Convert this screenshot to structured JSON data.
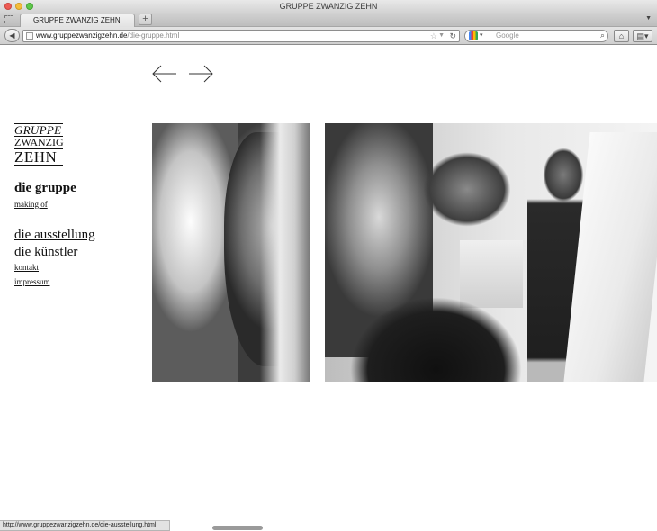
{
  "window": {
    "title": "GRUPPE ZWANZIG ZEHN"
  },
  "tabs": [
    {
      "label": "GRUPPE ZWANZIG ZEHN"
    }
  ],
  "toolbar": {
    "back_glyph": "◀",
    "new_tab_glyph": "+",
    "url_host": "www.gruppezwanzigzehn.de",
    "url_path": "/die-gruppe.html",
    "search_placeholder": "Google",
    "home_glyph": "⌂",
    "bookmarks_glyph": "▤▾"
  },
  "logo": {
    "line1": "GRUPPE",
    "line2": "ZWANZIG",
    "line3": "ZEHN"
  },
  "nav": {
    "die_gruppe": "die gruppe",
    "making_of": "making of",
    "die_ausstellung": "die ausstellung",
    "die_kuenstler": "die künstler",
    "kontakt": "kontakt",
    "impressum": "impressum"
  },
  "status_bar": {
    "text": "http://www.gruppezwanzigzehn.de/die-ausstellung.html"
  },
  "colors": {
    "page_background": "#ffffff",
    "text": "#111111"
  }
}
